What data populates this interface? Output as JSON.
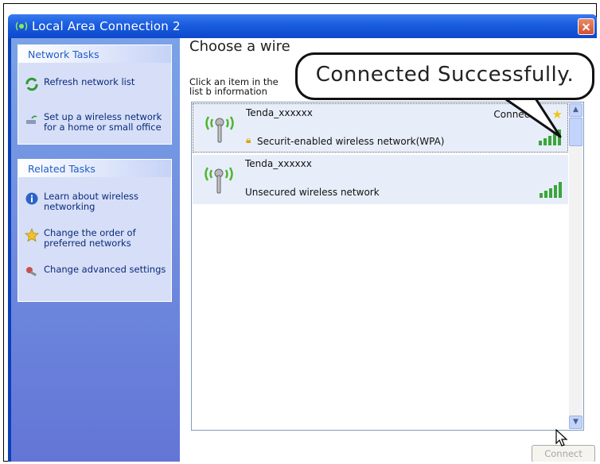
{
  "window": {
    "title": "Local Area Connection 2"
  },
  "sidebar": {
    "network_tasks": {
      "header": "Network Tasks",
      "items": [
        {
          "label": "Refresh network list"
        },
        {
          "label": "Set up a wireless network for a home or small office"
        }
      ]
    },
    "related_tasks": {
      "header": "Related Tasks",
      "items": [
        {
          "label": "Learn about wireless networking"
        },
        {
          "label": "Change the order of preferred networks"
        },
        {
          "label": "Change advanced settings"
        }
      ]
    }
  },
  "main": {
    "heading": "Choose a wire",
    "instruction": "Click an item in the list b information",
    "networks": [
      {
        "name": "Tenda_xxxxxx",
        "status": "Connected",
        "description": "Securit-enabled wireless network(WPA)",
        "selected": true
      },
      {
        "name": "Tenda_xxxxxx",
        "status": "",
        "description": "Unsecured wireless network",
        "selected": false
      }
    ],
    "connect_button": "Connect"
  },
  "callout": {
    "text": "Connected Successfully."
  },
  "colors": {
    "title_bar": "#1c5fe0",
    "sidebar": "#6f8ee0",
    "signal": "#3aa63a"
  }
}
